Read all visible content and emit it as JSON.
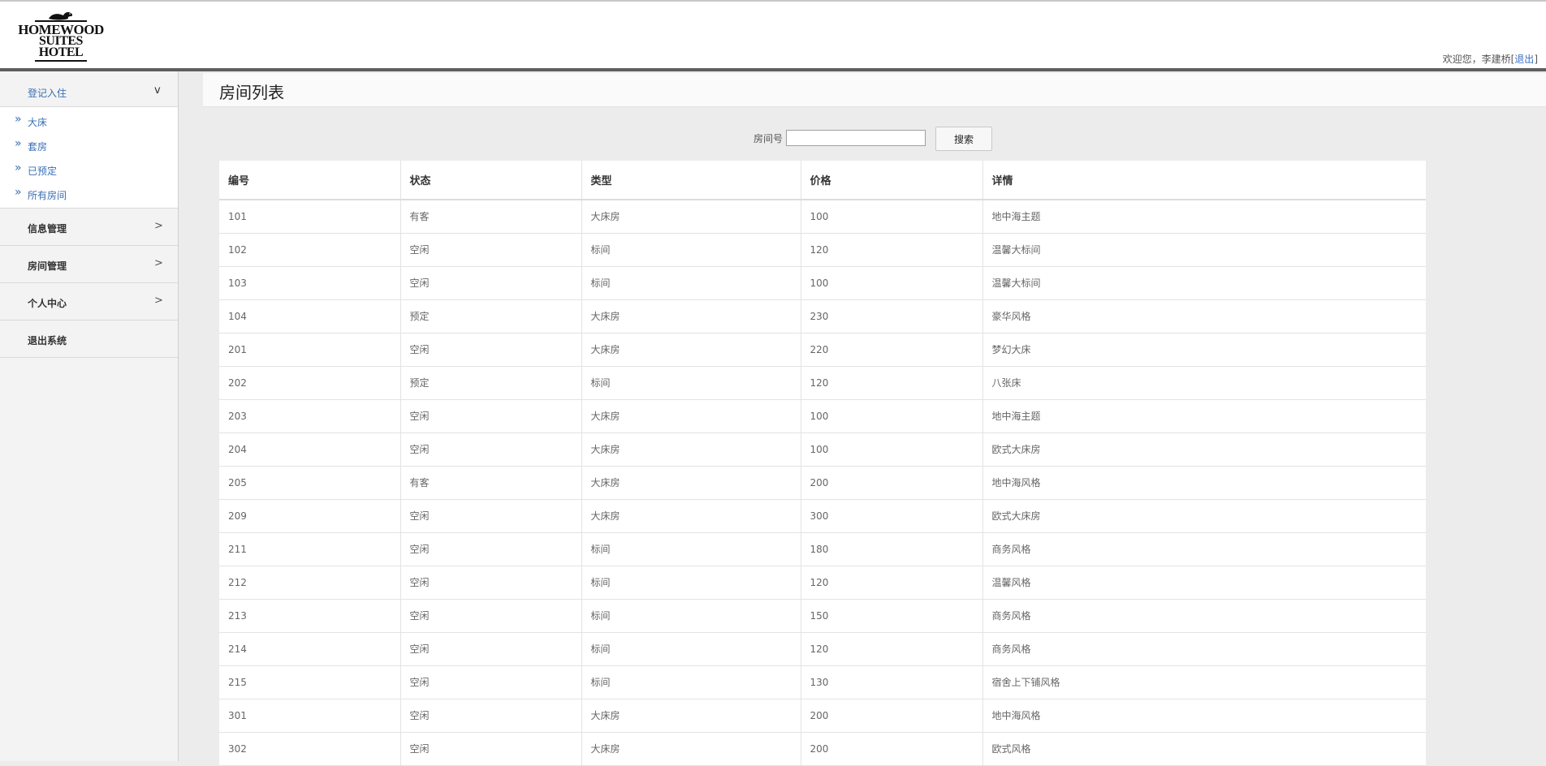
{
  "logo": {
    "line1": "HOMEWOOD",
    "line2": "SUITES",
    "line3": "HOTEL"
  },
  "header": {
    "welcome": "欢迎您，李建桥[",
    "logout": "退出",
    "close_bracket": "]"
  },
  "sidebar": {
    "open_group": {
      "label": "登记入住",
      "arrow": "v",
      "items": [
        {
          "label": "大床"
        },
        {
          "label": "套房"
        },
        {
          "label": "已预定"
        },
        {
          "label": "所有房间"
        }
      ]
    },
    "groups": [
      {
        "label": "信息管理",
        "arrow": ">"
      },
      {
        "label": "房间管理",
        "arrow": ">"
      },
      {
        "label": "个人中心",
        "arrow": ">"
      },
      {
        "label": "退出系统",
        "arrow": ""
      }
    ]
  },
  "page": {
    "title": "房间列表"
  },
  "search": {
    "label": "房间号",
    "value": "",
    "placeholder": "",
    "button": "搜索"
  },
  "table": {
    "headers": [
      "编号",
      "状态",
      "类型",
      "价格",
      "详情"
    ],
    "rows": [
      [
        "101",
        "有客",
        "大床房",
        "100",
        "地中海主题"
      ],
      [
        "102",
        "空闲",
        "标间",
        "120",
        "温馨大标间"
      ],
      [
        "103",
        "空闲",
        "标间",
        "100",
        "温馨大标间"
      ],
      [
        "104",
        "预定",
        "大床房",
        "230",
        "豪华风格"
      ],
      [
        "201",
        "空闲",
        "大床房",
        "220",
        "梦幻大床"
      ],
      [
        "202",
        "预定",
        "标间",
        "120",
        "八张床"
      ],
      [
        "203",
        "空闲",
        "大床房",
        "100",
        "地中海主题"
      ],
      [
        "204",
        "空闲",
        "大床房",
        "100",
        "欧式大床房"
      ],
      [
        "205",
        "有客",
        "大床房",
        "200",
        "地中海风格"
      ],
      [
        "209",
        "空闲",
        "大床房",
        "300",
        "欧式大床房"
      ],
      [
        "211",
        "空闲",
        "标间",
        "180",
        "商务风格"
      ],
      [
        "212",
        "空闲",
        "标间",
        "120",
        "温馨风格"
      ],
      [
        "213",
        "空闲",
        "标间",
        "150",
        "商务风格"
      ],
      [
        "214",
        "空闲",
        "标间",
        "120",
        "商务风格"
      ],
      [
        "215",
        "空闲",
        "标间",
        "130",
        "宿舍上下铺风格"
      ],
      [
        "301",
        "空闲",
        "大床房",
        "200",
        "地中海风格"
      ],
      [
        "302",
        "空闲",
        "大床房",
        "200",
        "欧式风格"
      ]
    ]
  }
}
